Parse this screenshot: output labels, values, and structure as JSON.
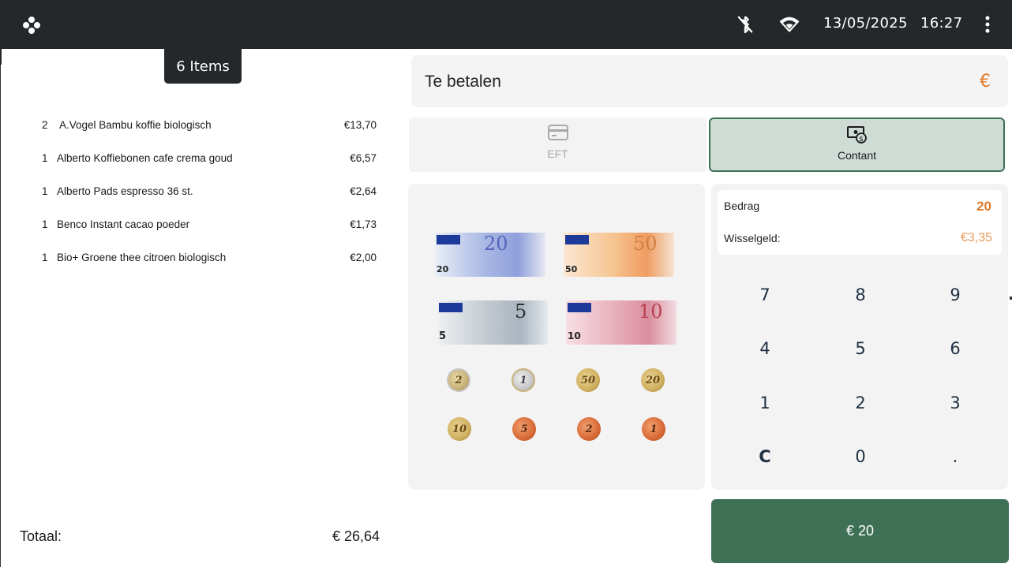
{
  "topbar": {
    "date": "13/05/2025",
    "time": "16:27",
    "icons": [
      "logo-icon",
      "bluetooth-disabled-icon",
      "wifi-icon",
      "more-vert-icon"
    ]
  },
  "order": {
    "item_count_label": "6 Items",
    "items": [
      {
        "qty": "2",
        "name": "A.Vogel Bambu koffie biologisch",
        "price": "€13,70"
      },
      {
        "qty": "1",
        "name": "Alberto Koffiebonen cafe crema goud",
        "price": "€6,57"
      },
      {
        "qty": "1",
        "name": "Alberto Pads espresso 36 st.",
        "price": "€2,64"
      },
      {
        "qty": "1",
        "name": "Benco Instant cacao poeder",
        "price": "€1,73"
      },
      {
        "qty": "1",
        "name": "Bio+ Groene thee citroen biologisch",
        "price": "€2,00"
      }
    ],
    "total_label": "Totaal:",
    "total_value": "€ 26,64"
  },
  "payment": {
    "title": "Te betalen",
    "currency_symbol": "€",
    "methods": [
      {
        "label": "EFT",
        "icon": "credit-card-icon",
        "selected": false
      },
      {
        "label": "Contant",
        "icon": "cash-icon",
        "selected": true
      }
    ]
  },
  "money": {
    "notes": [
      "20",
      "50",
      "5",
      "10"
    ],
    "coins": [
      "2",
      "1",
      "50",
      "20",
      "10",
      "5",
      "2",
      "1"
    ]
  },
  "cash": {
    "amount_label": "Bedrag",
    "amount_value": "20",
    "change_label": "Wisselgeld:",
    "change_value": "€3,35"
  },
  "keypad": {
    "keys": [
      "7",
      "8",
      "9",
      "4",
      "5",
      "6",
      "1",
      "2",
      "3",
      "C",
      "0",
      "."
    ]
  },
  "confirm_label": "€ 20",
  "colors": {
    "topbar": "#24282b",
    "accent_green": "#3e7056",
    "selected_tab_bg": "#cfdcd5",
    "orange": "#e07a2a",
    "panel_bg": "#f3f3f3"
  }
}
